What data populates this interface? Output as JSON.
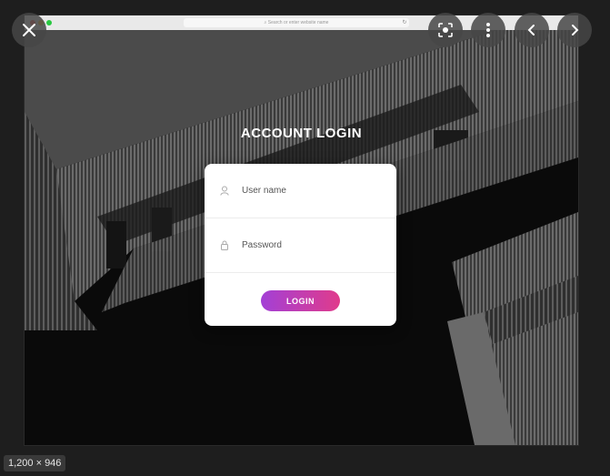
{
  "browser": {
    "url_placeholder": "Search or enter website name"
  },
  "login": {
    "title": "ACCOUNT LOGIN",
    "username_placeholder": "User name",
    "password_placeholder": "Password",
    "button_label": "LOGIN"
  },
  "viewer": {
    "dimensions": "1,200 × 946",
    "close_icon": "close-icon",
    "lens_icon": "lens-icon",
    "more_icon": "more-vertical-icon",
    "prev_icon": "chevron-left-icon",
    "next_icon": "chevron-right-icon"
  },
  "colors": {
    "button_gradient_start": "#a340d6",
    "button_gradient_end": "#e03b8b",
    "card_bg": "#ffffff",
    "background": "#0a0a0a"
  }
}
